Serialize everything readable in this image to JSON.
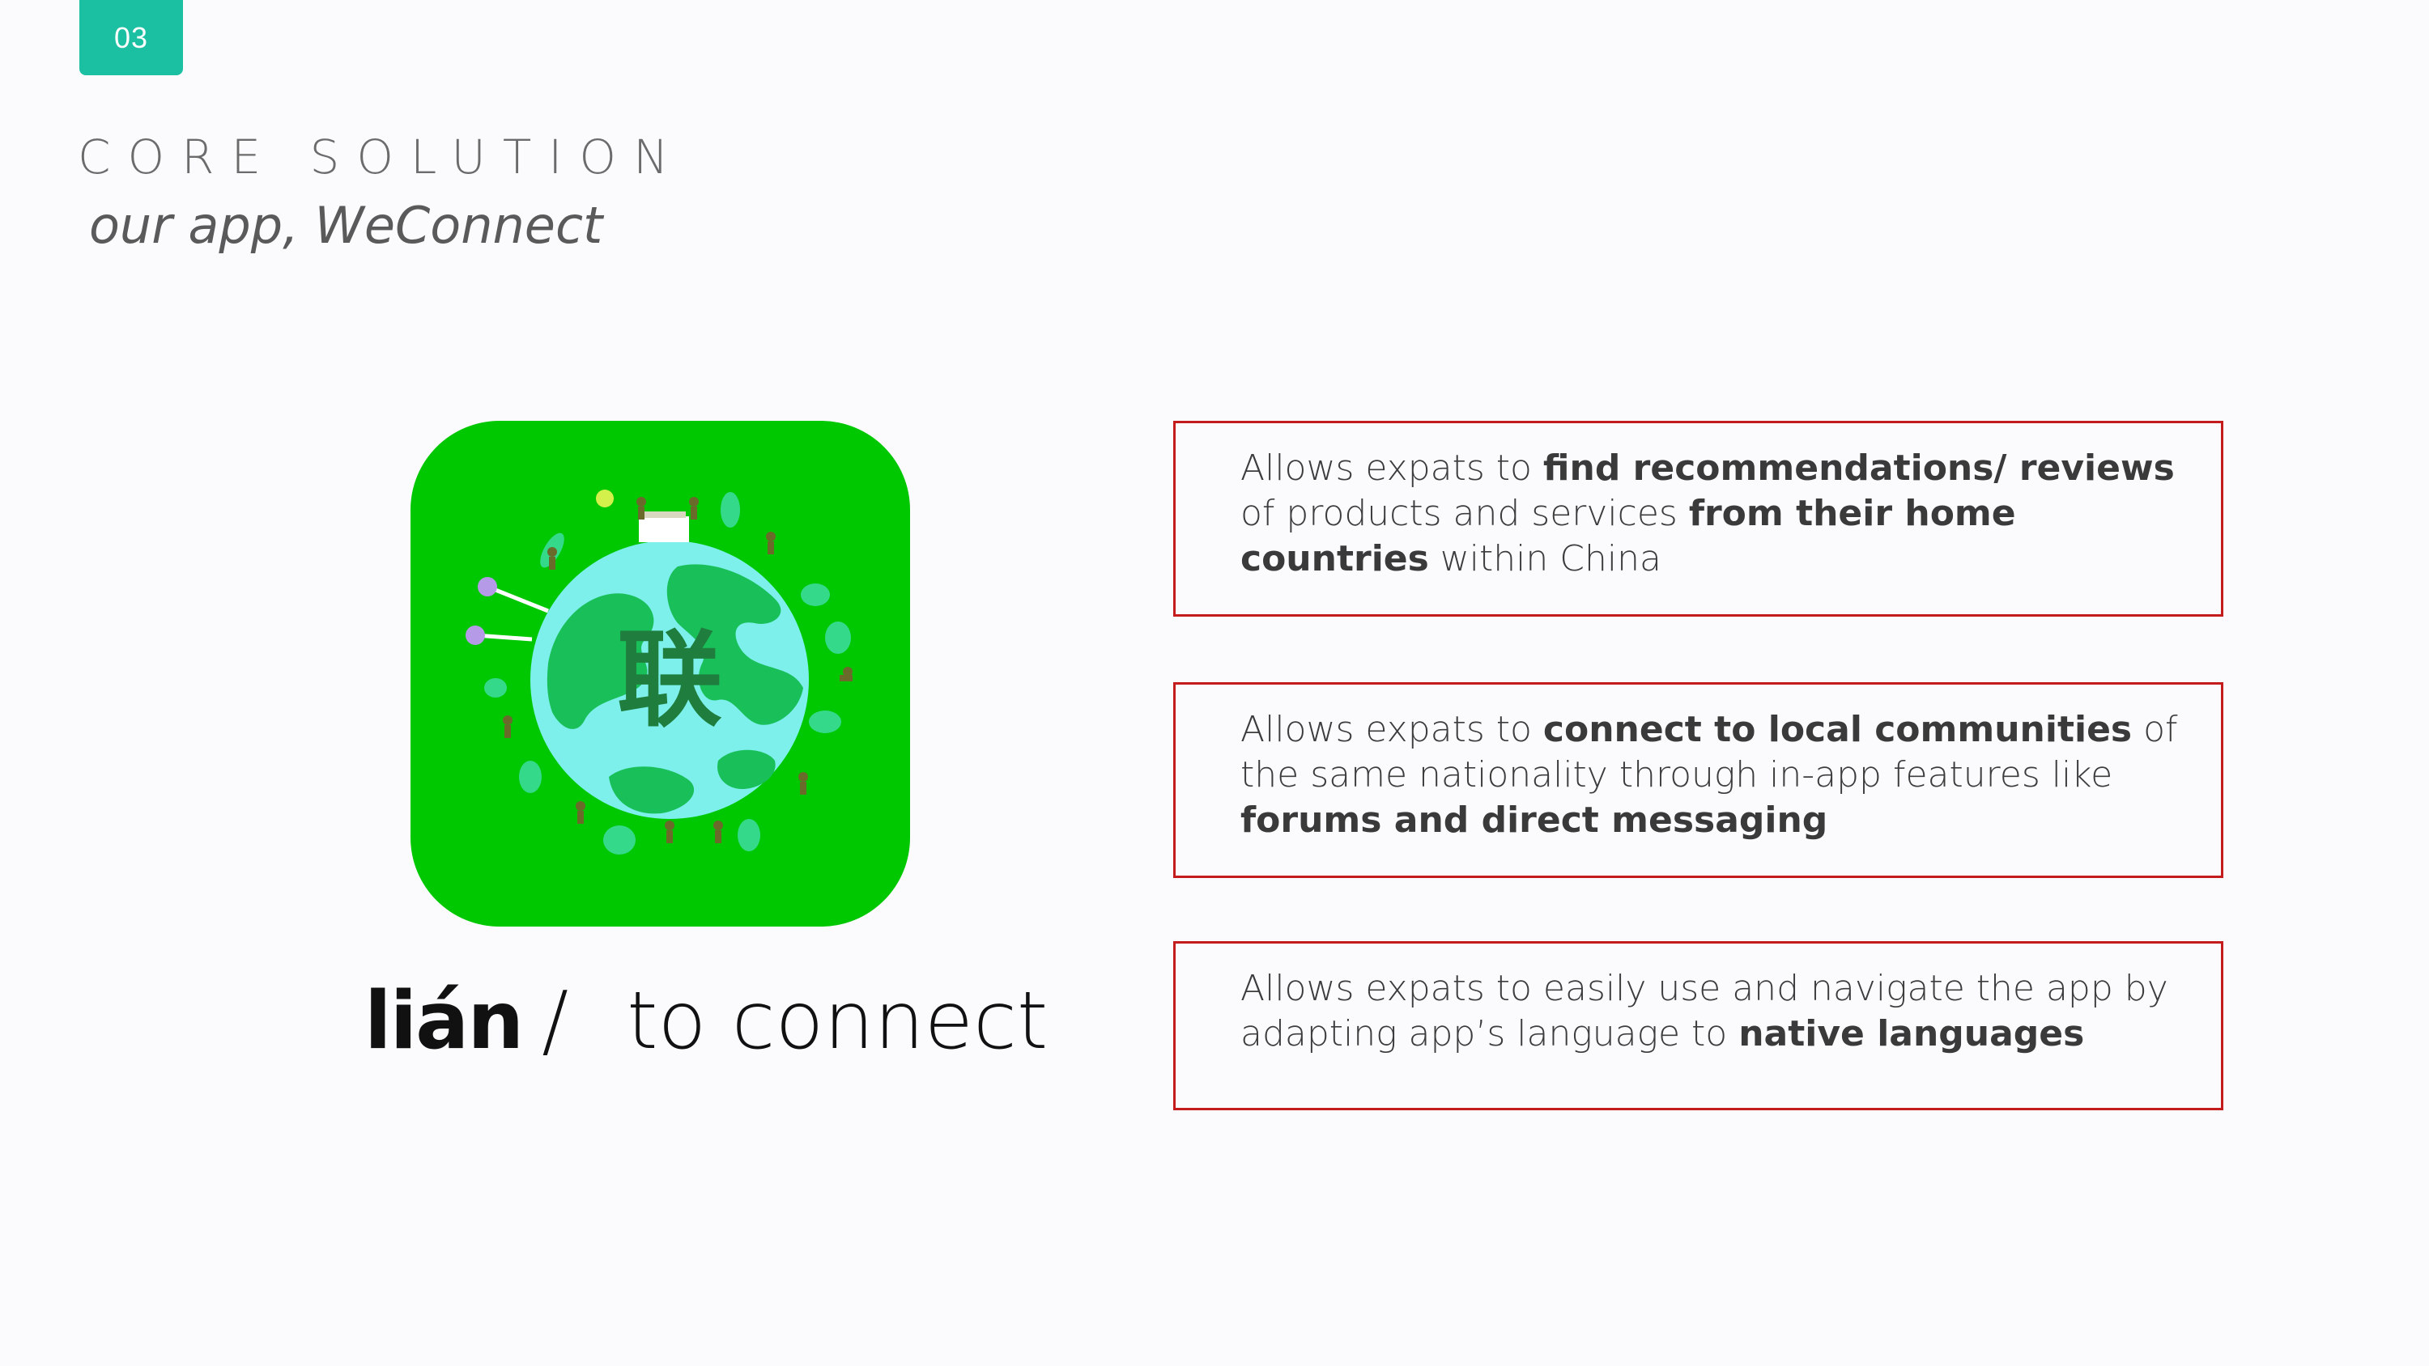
{
  "slide": {
    "badge": "03",
    "title": "CORE SOLUTION",
    "subtitle": "our app, WeConnect"
  },
  "app_icon": {
    "glyph": "联",
    "icon_name": "globe-people-icon",
    "colors": {
      "background": "#00c800",
      "ocean": "#7ef0ec",
      "land": "#19c05a",
      "glyph": "#1f7e3e"
    }
  },
  "caption": {
    "pinyin": "lián",
    "slash": "/",
    "meaning": "to connect"
  },
  "features": [
    {
      "s1": "Allows expats to ",
      "b1": "find recommendations/ reviews",
      "s2": " of products and services ",
      "b2": "from their home countries",
      "s3": " within China"
    },
    {
      "s1": "Allows expats to ",
      "b1": "connect to local communities",
      "s2": " of the same nationality through in-app features like ",
      "b2": "forums and direct messaging",
      "s3": ""
    },
    {
      "s1": "Allows expats to easily use and navigate the app by adapting app’s language to ",
      "b1": "native languages",
      "s2": "",
      "b2": "",
      "s3": ""
    }
  ],
  "colors": {
    "badge": "#1bbfa2",
    "box_border": "#c41c1c",
    "background": "#fbfbfe"
  }
}
